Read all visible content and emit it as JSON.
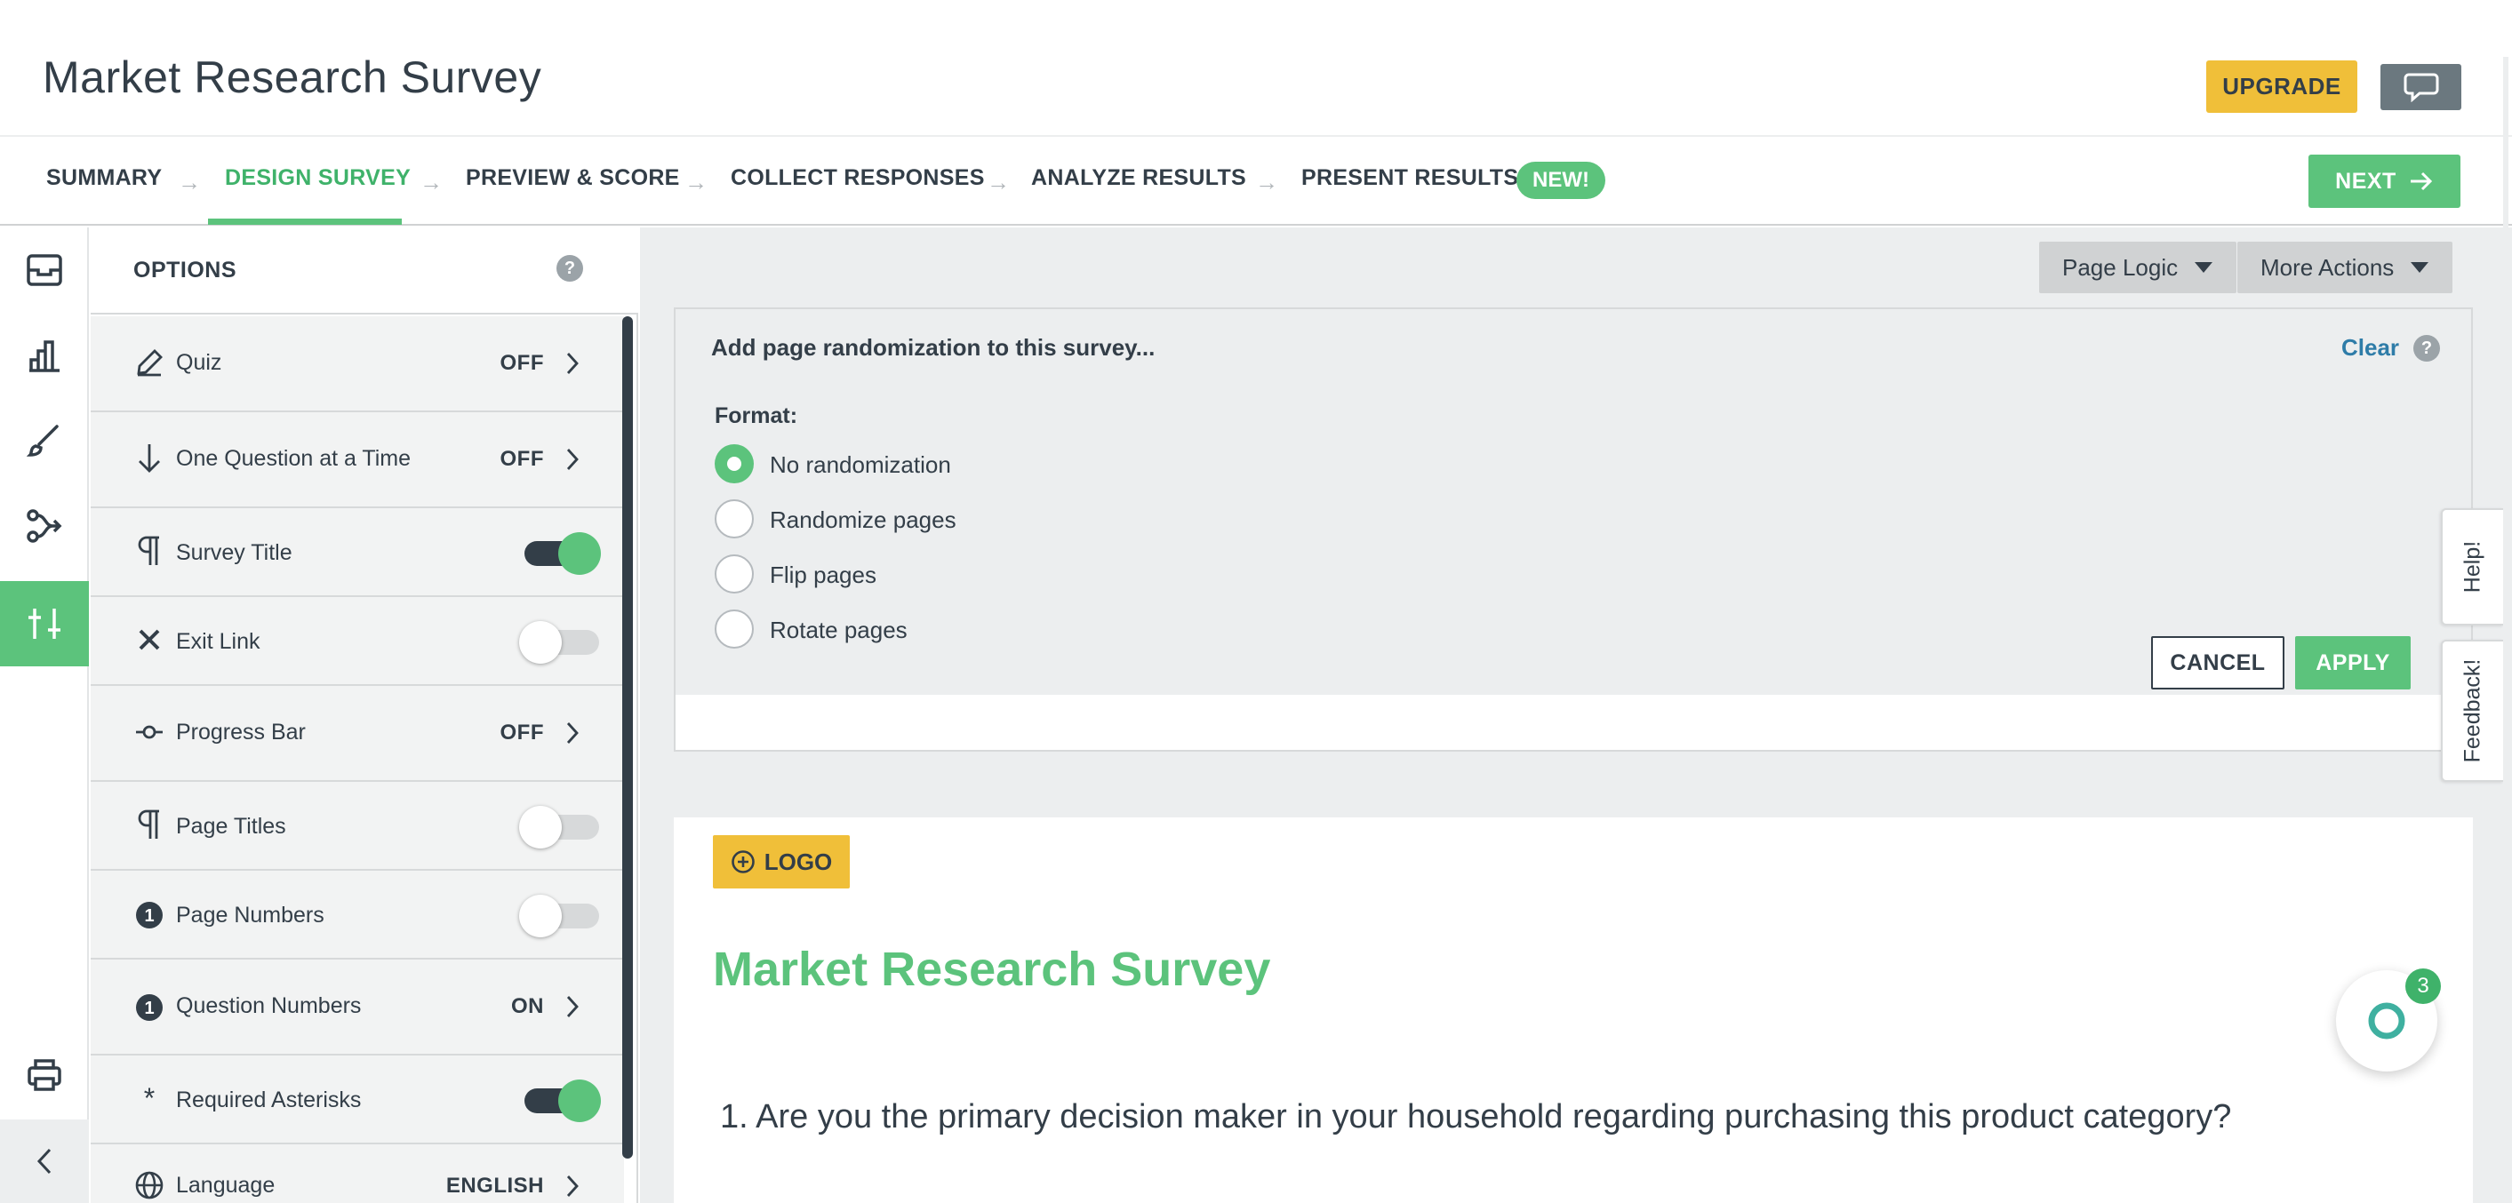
{
  "header": {
    "title": "Market Research Survey",
    "upgrade_label": "UPGRADE"
  },
  "steps": {
    "items": [
      "SUMMARY",
      "DESIGN SURVEY",
      "PREVIEW & SCORE",
      "COLLECT RESPONSES",
      "ANALYZE RESULTS",
      "PRESENT RESULTS"
    ],
    "active": "DESIGN SURVEY",
    "new_badge": "NEW!",
    "next_label": "NEXT"
  },
  "options": {
    "heading": "OPTIONS",
    "help": "?",
    "rows": [
      {
        "label": "Quiz",
        "value": "OFF",
        "icon": "pencil-icon"
      },
      {
        "label": "One Question at a Time",
        "value": "OFF",
        "icon": "arrow-down-icon"
      },
      {
        "label": "Survey Title",
        "value": "",
        "icon": "paragraph-icon",
        "toggle": "on"
      },
      {
        "label": "Exit Link",
        "value": "",
        "icon": "close-icon",
        "toggle": "off"
      },
      {
        "label": "Progress Bar",
        "value": "OFF",
        "icon": "progress-icon"
      },
      {
        "label": "Page Titles",
        "value": "",
        "icon": "paragraph-icon",
        "toggle": "off"
      },
      {
        "label": "Page Numbers",
        "value": "",
        "icon": "number-one-icon",
        "toggle": "off"
      },
      {
        "label": "Question Numbers",
        "value": "ON",
        "icon": "number-one-icon"
      },
      {
        "label": "Required Asterisks",
        "value": "",
        "icon": "asterisk-icon",
        "toggle": "on"
      },
      {
        "label": "Language",
        "value": "ENGLISH",
        "icon": "globe-icon"
      }
    ],
    "number_glyph": "1",
    "asterisk_glyph": "*"
  },
  "toolbar": {
    "page_logic": "Page Logic",
    "more_actions": "More Actions"
  },
  "randomization": {
    "title": "Add page randomization to this survey...",
    "clear": "Clear",
    "help": "?",
    "format_label": "Format:",
    "choices": [
      "No randomization",
      "Randomize pages",
      "Flip pages",
      "Rotate pages"
    ],
    "selected": "No randomization",
    "cancel": "CANCEL",
    "apply": "APPLY"
  },
  "canvas": {
    "logo_label": "LOGO",
    "title": "Market Research Survey",
    "question": "1. Are you the primary decision maker in your household regarding purchasing this product category?"
  },
  "side_tabs": {
    "help": "Help!",
    "feedback": "Feedback!"
  },
  "fab": {
    "badge": "3"
  },
  "colors": {
    "accent_green": "#5cc37c",
    "upgrade_yellow": "#f0bf39",
    "link_blue": "#2e7ca8",
    "text_dark": "#333e48"
  }
}
